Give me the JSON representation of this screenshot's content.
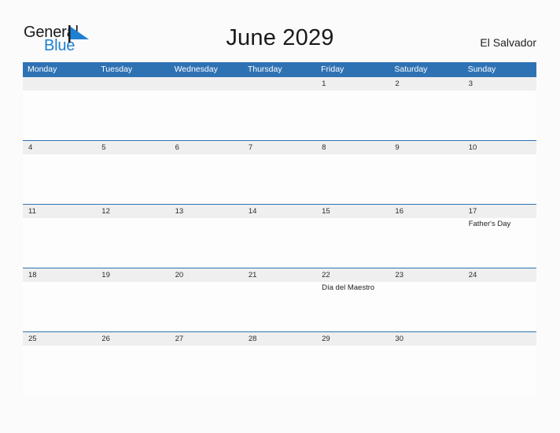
{
  "brand": {
    "name_part1": "General",
    "name_part2": "Blue",
    "flag_icon": "blue-flag-triangle",
    "accent_color": "#1f7fd0"
  },
  "header": {
    "title": "June 2029",
    "country": "El Salvador"
  },
  "theme": {
    "header_row_bg": "#2f72b4",
    "header_row_text": "#ffffff",
    "daynum_strip_bg": "#efefef",
    "week_separator": "#2f72b4",
    "page_bg": "#fbfbfc",
    "body_text": "#1f1f1f"
  },
  "calendar": {
    "month": "June",
    "year": "2029",
    "weekday_headers": [
      "Monday",
      "Tuesday",
      "Wednesday",
      "Thursday",
      "Friday",
      "Saturday",
      "Sunday"
    ],
    "weeks": [
      {
        "days": [
          {
            "num": "",
            "events": []
          },
          {
            "num": "",
            "events": []
          },
          {
            "num": "",
            "events": []
          },
          {
            "num": "",
            "events": []
          },
          {
            "num": "1",
            "events": []
          },
          {
            "num": "2",
            "events": []
          },
          {
            "num": "3",
            "events": []
          }
        ]
      },
      {
        "days": [
          {
            "num": "4",
            "events": []
          },
          {
            "num": "5",
            "events": []
          },
          {
            "num": "6",
            "events": []
          },
          {
            "num": "7",
            "events": []
          },
          {
            "num": "8",
            "events": []
          },
          {
            "num": "9",
            "events": []
          },
          {
            "num": "10",
            "events": []
          }
        ]
      },
      {
        "days": [
          {
            "num": "11",
            "events": []
          },
          {
            "num": "12",
            "events": []
          },
          {
            "num": "13",
            "events": []
          },
          {
            "num": "14",
            "events": []
          },
          {
            "num": "15",
            "events": []
          },
          {
            "num": "16",
            "events": []
          },
          {
            "num": "17",
            "events": [
              "Father's Day"
            ]
          }
        ]
      },
      {
        "days": [
          {
            "num": "18",
            "events": []
          },
          {
            "num": "19",
            "events": []
          },
          {
            "num": "20",
            "events": []
          },
          {
            "num": "21",
            "events": []
          },
          {
            "num": "22",
            "events": [
              "Día del Maestro"
            ]
          },
          {
            "num": "23",
            "events": []
          },
          {
            "num": "24",
            "events": []
          }
        ]
      },
      {
        "days": [
          {
            "num": "25",
            "events": []
          },
          {
            "num": "26",
            "events": []
          },
          {
            "num": "27",
            "events": []
          },
          {
            "num": "28",
            "events": []
          },
          {
            "num": "29",
            "events": []
          },
          {
            "num": "30",
            "events": []
          },
          {
            "num": "",
            "events": []
          }
        ]
      }
    ]
  }
}
